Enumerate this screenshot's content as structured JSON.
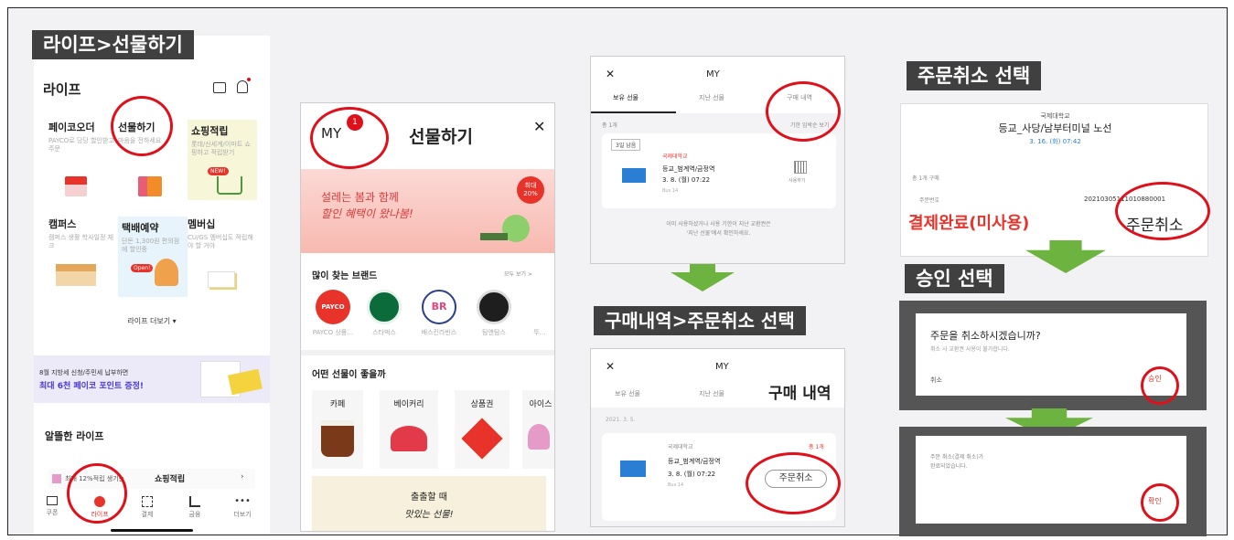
{
  "section_headers": {
    "life_gift": "라이프>선물하기",
    "purchase_cancel": "구매내역>주문취소 선택",
    "order_cancel": "주문취소 선택",
    "approve": "승인 선택"
  },
  "life_screen": {
    "title": "라이프",
    "tiles": [
      {
        "title": "페이코오더",
        "sub": "PAYCO로 당당 할인받고 주문"
      },
      {
        "title": "선물하기",
        "sub": "마음을 전하세요"
      },
      {
        "title": "쇼핑적립",
        "sub": "롯데/신세계/이마트 쇼핑하고 적립받기",
        "badge": "NEW!"
      },
      {
        "title": "캠퍼스",
        "sub": "캠퍼스 생활 학사일정 체크"
      },
      {
        "title": "택배예약",
        "sub": "단돈 1,300원 편의점에 할인중",
        "badge": "Open!"
      },
      {
        "title": "멤버십",
        "sub": "CU/GS 멤버십도 적립해야 할 거야"
      }
    ],
    "more": "라이프 더보기 ▾",
    "banner_line1": "8월 지방세 신청/주민세 납부하면",
    "banner_line2": "최대 6천 페이코 포인트 증정!",
    "section": "알뜰한 라이프",
    "promo_text": "최대 12%적립 생기는",
    "promo_bold": "쇼핑적립",
    "nav": [
      "쿠폰",
      "라이프",
      "결제",
      "금융",
      "더보기"
    ]
  },
  "gift_screen": {
    "my": "MY",
    "badge": "1",
    "title": "선물하기",
    "banner_line1": "설레는 봄과 함께",
    "banner_line2": "할인 혜택이 왔나봄!",
    "banner_badge": "최대 20%",
    "brands_title": "많이 찾는 브랜드",
    "brands_more": "모두 보기 >",
    "brands": [
      {
        "name": "PAYCO 상품…",
        "logo": "PAYCO"
      },
      {
        "name": "스타벅스",
        "logo": ""
      },
      {
        "name": "배스킨라빈스",
        "logo": "BR"
      },
      {
        "name": "탐앤탐스",
        "logo": ""
      },
      {
        "name": "뚜…",
        "logo": ""
      }
    ],
    "cat_title": "어떤 선물이 좋을까",
    "categories": [
      "카페",
      "베이커리",
      "상품권",
      "아이스"
    ],
    "footer_line1": "출출할 때",
    "footer_line2": "맛있는 선물!"
  },
  "my_top": {
    "title": "MY",
    "tabs": [
      "보유 선물",
      "지난 선물",
      "구매 내역"
    ],
    "count": "총 1개",
    "days_tag": "3일 남음",
    "sub_header": "기한 임박순 보기",
    "issuer": "국제대학교",
    "product": "등교_범계역/금정역",
    "date": "3. 8. (월) 07:22",
    "code": "Bus 14",
    "barcode_label": "사용하기",
    "note_line1": "이미 사용하셨거나 사용 기한이 지난 교환권은",
    "note_line2": "'지난 선물'에서 확인하세요."
  },
  "my_bottom": {
    "title": "MY",
    "tabs": [
      "보유 선물",
      "지난 선물",
      "구매 내역"
    ],
    "date_row": "2021. 3. 5.",
    "issuer": "국제대학교",
    "count": "총 1개",
    "product": "등교_범계역/금정역",
    "date": "3. 8. (월) 07:22",
    "code": "Bus 14",
    "cancel_btn": "주문취소"
  },
  "order_screen": {
    "org": "국제대학교",
    "route": "등교_사당/남부터미널 노선",
    "date": "3. 16. (화) 07:42",
    "count": "총 1개 구매",
    "order_no_label": "주문번호",
    "order_no": "20210305111010880001",
    "status": "결제완료(미사용)",
    "cancel_btn": "주문취소"
  },
  "confirm_dialog": {
    "question": "주문을 취소하시겠습니까?",
    "sub": "취소 시 교환권 사용이 불가합니다.",
    "cancel": "취소",
    "approve": "승인"
  },
  "done_dialog": {
    "line1": "주문 취소(결제 취소)가",
    "line2": "완료되었습니다.",
    "ok": "확인"
  },
  "colors": {
    "header_bg": "#404040",
    "ring": "#e0101a",
    "arrow": "#6cb33f",
    "accent_red": "#e8332a",
    "dialog_frame": "#555555"
  }
}
